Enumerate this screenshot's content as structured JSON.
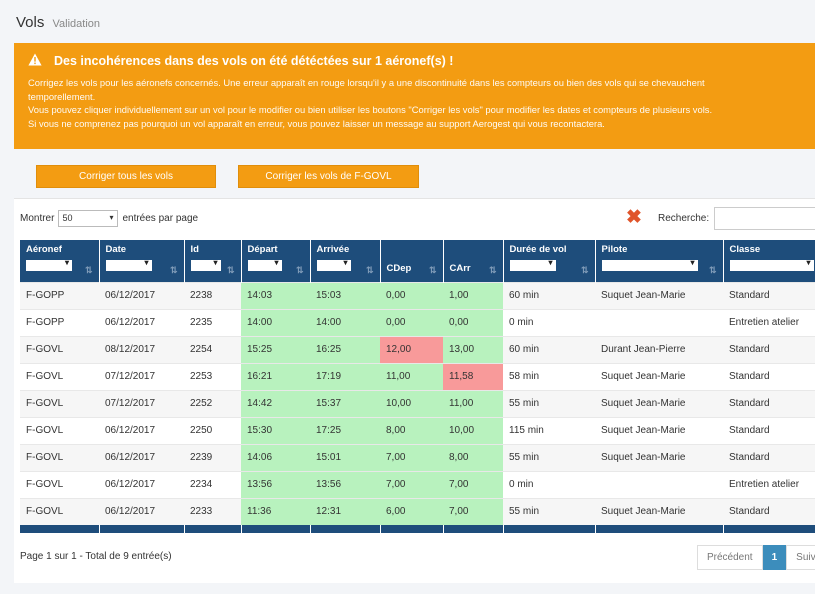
{
  "header": {
    "title": "Vols",
    "subtitle": "Validation"
  },
  "alert": {
    "icon": "warning-icon",
    "title": "Des incohérences dans des vols on été détéctées sur 1 aéronef(s) !",
    "lines": [
      "Corrigez les vols pour les aéronefs concernés. Une erreur apparaît en rouge lorsqu'il y a une discontinuité dans les compteurs ou bien des vols qui se chevauchent",
      "temporellement.",
      "Vous pouvez cliquer individuellement sur un vol pour le modifier ou bien utiliser les boutons \"Corriger les vols\" pour modifier les dates et compteurs de plusieurs vols.",
      "Si vous ne comprenez pas pourquoi un vol apparaît en erreur, vous pouvez laisser un message au support Aerogest qui vous recontactera."
    ]
  },
  "actions": {
    "fix_all": "Corriger tous les vols",
    "fix_aircraft": "Corriger les vols de F-GOVL"
  },
  "table_controls": {
    "show_label": "Montrer",
    "page_size": "50",
    "per_page_label": "entrées par page",
    "search_label": "Recherche:",
    "search_value": ""
  },
  "columns": [
    "Aéronef",
    "Date",
    "Id",
    "Départ",
    "Arrivée",
    "CDep",
    "CArr",
    "Durée de vol",
    "Pilote",
    "Classe"
  ],
  "rows": [
    [
      "F-GOPP",
      "06/12/2017",
      "2238",
      "14:03",
      "15:03",
      "0,00",
      "1,00",
      "60 min",
      "Suquet Jean-Marie",
      "Standard"
    ],
    [
      "F-GOPP",
      "06/12/2017",
      "2235",
      "14:00",
      "14:00",
      "0,00",
      "0,00",
      "0 min",
      "",
      "Entretien atelier"
    ],
    [
      "F-GOVL",
      "08/12/2017",
      "2254",
      "15:25",
      "16:25",
      "12,00",
      "13,00",
      "60 min",
      "Durant Jean-Pierre",
      "Standard"
    ],
    [
      "F-GOVL",
      "07/12/2017",
      "2253",
      "16:21",
      "17:19",
      "11,00",
      "11,58",
      "58 min",
      "Suquet Jean-Marie",
      "Standard"
    ],
    [
      "F-GOVL",
      "07/12/2017",
      "2252",
      "14:42",
      "15:37",
      "10,00",
      "11,00",
      "55 min",
      "Suquet Jean-Marie",
      "Standard"
    ],
    [
      "F-GOVL",
      "06/12/2017",
      "2250",
      "15:30",
      "17:25",
      "8,00",
      "10,00",
      "115 min",
      "Suquet Jean-Marie",
      "Standard"
    ],
    [
      "F-GOVL",
      "06/12/2017",
      "2239",
      "14:06",
      "15:01",
      "7,00",
      "8,00",
      "55 min",
      "Suquet Jean-Marie",
      "Standard"
    ],
    [
      "F-GOVL",
      "06/12/2017",
      "2234",
      "13:56",
      "13:56",
      "7,00",
      "7,00",
      "0 min",
      "",
      "Entretien atelier"
    ],
    [
      "F-GOVL",
      "06/12/2017",
      "2233",
      "11:36",
      "12:31",
      "6,00",
      "7,00",
      "55 min",
      "Suquet Jean-Marie",
      "Standard"
    ]
  ],
  "error_cells": [
    [
      2,
      5
    ],
    [
      3,
      6
    ]
  ],
  "colors": {
    "ok": "#b8f2be",
    "error": "#f89a9a",
    "header": "#1e4d7b",
    "accent": "#f39c12"
  },
  "footer": {
    "info": "Page 1 sur 1 - Total de 9 entrée(s)",
    "prev": "Précédent",
    "page": "1",
    "next": "Suivant"
  }
}
